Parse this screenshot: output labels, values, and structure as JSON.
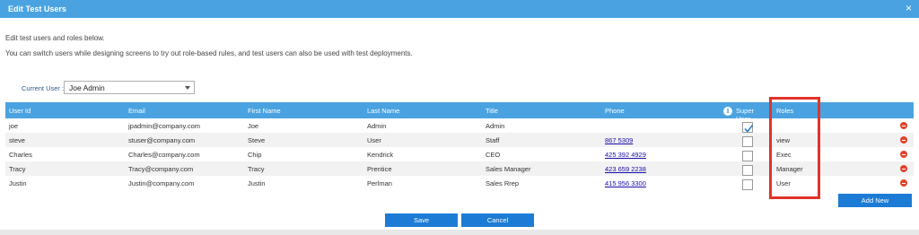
{
  "window": {
    "title": "Edit Test Users",
    "close_glyph": "×"
  },
  "intro": {
    "line1": "Edit test users and roles below.",
    "line2": "You can switch users while designing screens to try out role-based rules, and test users can also be used with test deployments."
  },
  "current_user": {
    "label": "Current User :",
    "value": "Joe Admin"
  },
  "table": {
    "columns": [
      "User Id",
      "Email",
      "First Name",
      "Last Name",
      "Title",
      "Phone",
      "Super User",
      "Roles"
    ],
    "rows": [
      {
        "user_id": "joe",
        "email": "jpadmin@company.com",
        "first_name": "Joe",
        "last_name": "Admin",
        "title": "Admin",
        "phone": "",
        "super_user": true,
        "roles": ""
      },
      {
        "user_id": "steve",
        "email": "stuser@company.com",
        "first_name": "Steve",
        "last_name": "User",
        "title": "Staff",
        "phone": "867 5309",
        "super_user": false,
        "roles": "view"
      },
      {
        "user_id": "Charles",
        "email": "Charles@company.com",
        "first_name": "Chip",
        "last_name": "Kendrick",
        "title": "CEO",
        "phone": "425 392 4929",
        "super_user": false,
        "roles": "Exec"
      },
      {
        "user_id": "Tracy",
        "email": "Tracy@company.com",
        "first_name": "Tracy",
        "last_name": "Prentice",
        "title": "Sales Manager",
        "phone": "423 659 2238",
        "super_user": false,
        "roles": "Manager"
      },
      {
        "user_id": "Justin",
        "email": "Justin@company.com",
        "first_name": "Justin",
        "last_name": "Perlman",
        "title": "Sales Rrep",
        "phone": "415 956 3300",
        "super_user": false,
        "roles": "User"
      }
    ]
  },
  "buttons": {
    "add_new": "Add New",
    "save": "Save",
    "cancel": "Cancel"
  },
  "colors": {
    "header": "#4aa3e0",
    "button": "#1c7cd5",
    "highlight": "#e0332a",
    "delete": "#e0432b"
  }
}
